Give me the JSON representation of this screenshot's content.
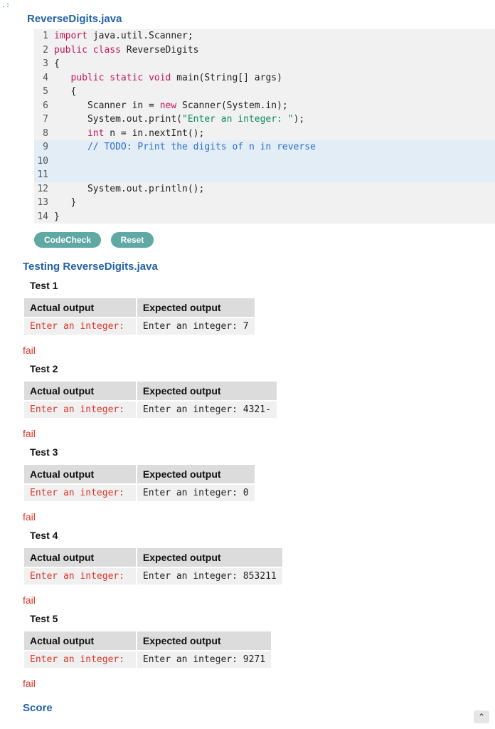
{
  "fileTitle": "ReverseDigits.java",
  "code": {
    "lines": [
      {
        "num": "1",
        "hl": false,
        "html": "<span class='tok-kw'>import</span><span class='tok-plain'> java.util.Scanner;</span>"
      },
      {
        "num": "2",
        "hl": false,
        "html": "<span class='tok-kw'>public</span><span class='tok-plain'> </span><span class='tok-kw'>class</span><span class='tok-plain'> ReverseDigits</span>"
      },
      {
        "num": "3",
        "hl": false,
        "html": "<span class='tok-plain'>{</span>"
      },
      {
        "num": "4",
        "hl": false,
        "html": "<span class='tok-plain'>   </span><span class='tok-kw'>public</span><span class='tok-plain'> </span><span class='tok-kw'>static</span><span class='tok-plain'> </span><span class='tok-kw'>void</span><span class='tok-plain'> main(String[] args)</span>"
      },
      {
        "num": "5",
        "hl": false,
        "html": "<span class='tok-plain'>   {</span>"
      },
      {
        "num": "6",
        "hl": false,
        "html": "<span class='tok-plain'>      Scanner in = </span><span class='tok-kw'>new</span><span class='tok-plain'> Scanner(System.in);</span>"
      },
      {
        "num": "7",
        "hl": false,
        "html": "<span class='tok-plain'>      System.out.print(</span><span class='tok-str'>\"Enter an integer: \"</span><span class='tok-plain'>);</span>"
      },
      {
        "num": "8",
        "hl": false,
        "html": "<span class='tok-plain'>      </span><span class='tok-kw'>int</span><span class='tok-plain'> n = in.nextInt();</span>"
      },
      {
        "num": "9",
        "hl": true,
        "html": "<span class='tok-plain'>      </span><span class='tok-comment'>// TODO: Print the digits of n in reverse</span>"
      },
      {
        "num": "10",
        "hl": true,
        "html": "<span class='tok-plain'> </span>"
      },
      {
        "num": "11",
        "hl": true,
        "html": "<span class='tok-plain'> </span>"
      },
      {
        "num": "12",
        "hl": false,
        "html": "<span class='tok-plain'>      System.out.println();</span>"
      },
      {
        "num": "13",
        "hl": false,
        "html": "<span class='tok-plain'>   }</span>"
      },
      {
        "num": "14",
        "hl": false,
        "html": "<span class='tok-plain'>}</span>"
      }
    ]
  },
  "buttons": {
    "codecheck": "CodeCheck",
    "reset": "Reset"
  },
  "testingTitle": "Testing ReverseDigits.java",
  "headers": {
    "actual": "Actual output",
    "expected": "Expected output"
  },
  "failLabel": "fail",
  "tests": [
    {
      "title": "Test 1",
      "actual": "Enter an integer: ",
      "expected": "Enter an integer: 7"
    },
    {
      "title": "Test 2",
      "actual": "Enter an integer: ",
      "expected": "Enter an integer: 4321-"
    },
    {
      "title": "Test 3",
      "actual": "Enter an integer: ",
      "expected": "Enter an integer: 0"
    },
    {
      "title": "Test 4",
      "actual": "Enter an integer: ",
      "expected": "Enter an integer: 853211"
    },
    {
      "title": "Test 5",
      "actual": "Enter an integer: ",
      "expected": "Enter an integer: 9271"
    }
  ],
  "scoreTitle": "Score",
  "cornerMark": ".:"
}
